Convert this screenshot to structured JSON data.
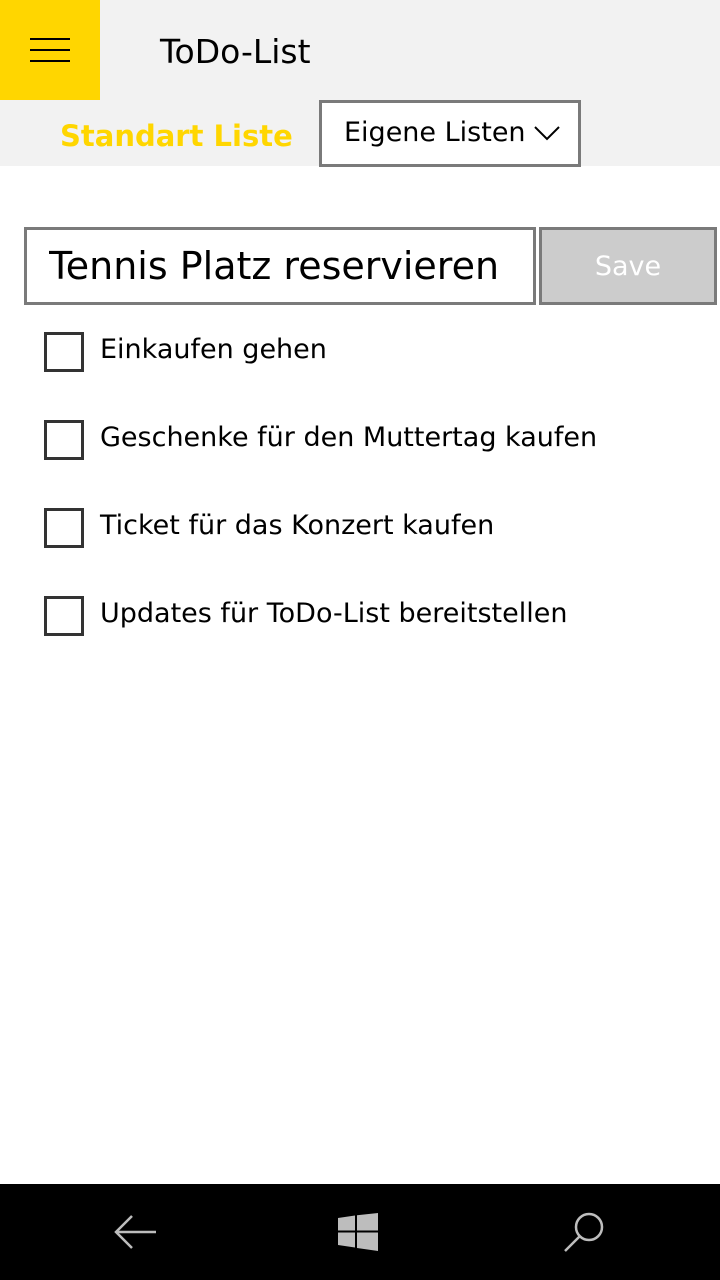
{
  "app": {
    "title": "ToDo-List",
    "accent_color": "#ffd600"
  },
  "menu": {
    "icon": "hamburger-icon"
  },
  "tabs": {
    "standard_label": "Standart Liste",
    "custom_lists_selected": "Eigene Listen"
  },
  "new_task": {
    "value": "Tennis Platz reservieren",
    "save_label": "Save"
  },
  "todos": [
    {
      "label": "Einkaufen gehen",
      "checked": false
    },
    {
      "label": "Geschenke für den Muttertag kaufen",
      "checked": false
    },
    {
      "label": "Ticket für das Konzert kaufen",
      "checked": false
    },
    {
      "label": "Updates für ToDo-List bereitstellen",
      "checked": false
    }
  ],
  "navbar": {
    "back_icon": "back-arrow-icon",
    "home_icon": "windows-logo-icon",
    "search_icon": "search-icon"
  }
}
